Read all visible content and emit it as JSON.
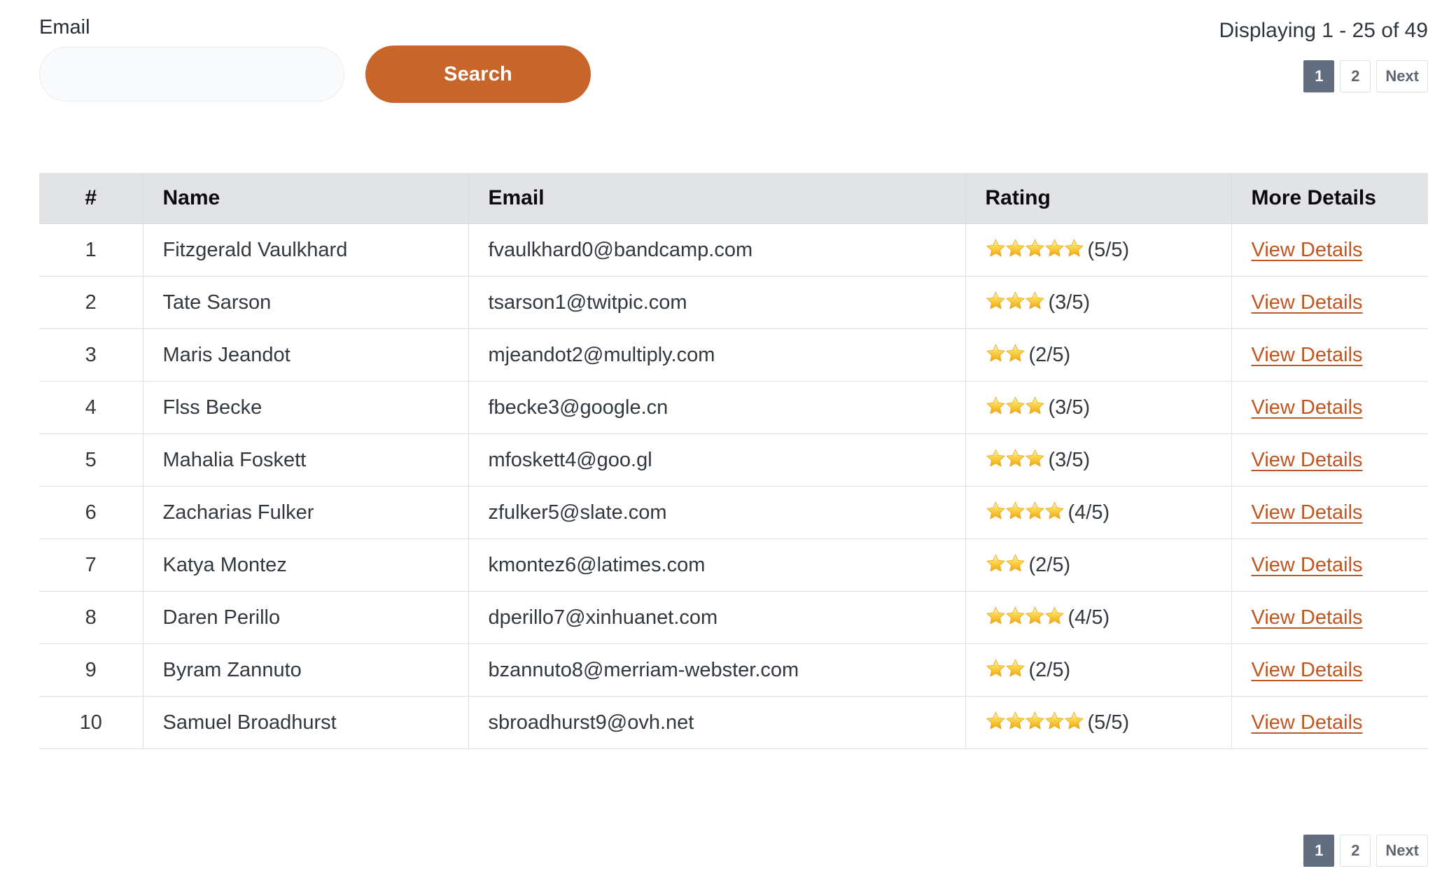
{
  "search": {
    "label": "Email",
    "input_value": "",
    "placeholder": "",
    "button_label": "Search"
  },
  "results": {
    "displaying_text": "Displaying 1 - 25 of 49",
    "range_start": 1,
    "range_end": 25,
    "total": 49
  },
  "pagination": {
    "pages": [
      {
        "label": "1",
        "active": true
      },
      {
        "label": "2",
        "active": false
      },
      {
        "label": "Next",
        "active": false
      }
    ],
    "active_color": "#626e80",
    "border_color": "#dee2e6"
  },
  "table": {
    "columns": [
      "#",
      "Name",
      "Email",
      "Rating",
      "More Details"
    ],
    "rows": [
      {
        "num": "1",
        "name": "Fitzgerald Vaulkhard",
        "email": "fvaulkhard0@bandcamp.com",
        "rating": 5,
        "rating_text": "(5/5)",
        "link_label": "View Details"
      },
      {
        "num": "2",
        "name": "Tate Sarson",
        "email": "tsarson1@twitpic.com",
        "rating": 3,
        "rating_text": "(3/5)",
        "link_label": "View Details"
      },
      {
        "num": "3",
        "name": "Maris Jeandot",
        "email": "mjeandot2@multiply.com",
        "rating": 2,
        "rating_text": "(2/5)",
        "link_label": "View Details"
      },
      {
        "num": "4",
        "name": "Flss Becke",
        "email": "fbecke3@google.cn",
        "rating": 3,
        "rating_text": "(3/5)",
        "link_label": "View Details"
      },
      {
        "num": "5",
        "name": "Mahalia Foskett",
        "email": "mfoskett4@goo.gl",
        "rating": 3,
        "rating_text": "(3/5)",
        "link_label": "View Details"
      },
      {
        "num": "6",
        "name": "Zacharias Fulker",
        "email": "zfulker5@slate.com",
        "rating": 4,
        "rating_text": "(4/5)",
        "link_label": "View Details"
      },
      {
        "num": "7",
        "name": "Katya Montez",
        "email": "kmontez6@latimes.com",
        "rating": 2,
        "rating_text": "(2/5)",
        "link_label": "View Details"
      },
      {
        "num": "8",
        "name": "Daren Perillo",
        "email": "dperillo7@xinhuanet.com",
        "rating": 4,
        "rating_text": "(4/5)",
        "link_label": "View Details"
      },
      {
        "num": "9",
        "name": "Byram Zannuto",
        "email": "bzannuto8@merriam-webster.com",
        "rating": 2,
        "rating_text": "(2/5)",
        "link_label": "View Details"
      },
      {
        "num": "10",
        "name": "Samuel Broadhurst",
        "email": "sbroadhurst9@ovh.net",
        "rating": 5,
        "rating_text": "(5/5)",
        "link_label": "View Details"
      }
    ]
  },
  "theme": {
    "accent_orange": "#c8652a",
    "link_orange": "#c05621",
    "star_gold": "#f5b715",
    "header_bg": "#e2e3e5",
    "pager_active": "#626e80"
  },
  "icons": {
    "star": "star-icon"
  }
}
